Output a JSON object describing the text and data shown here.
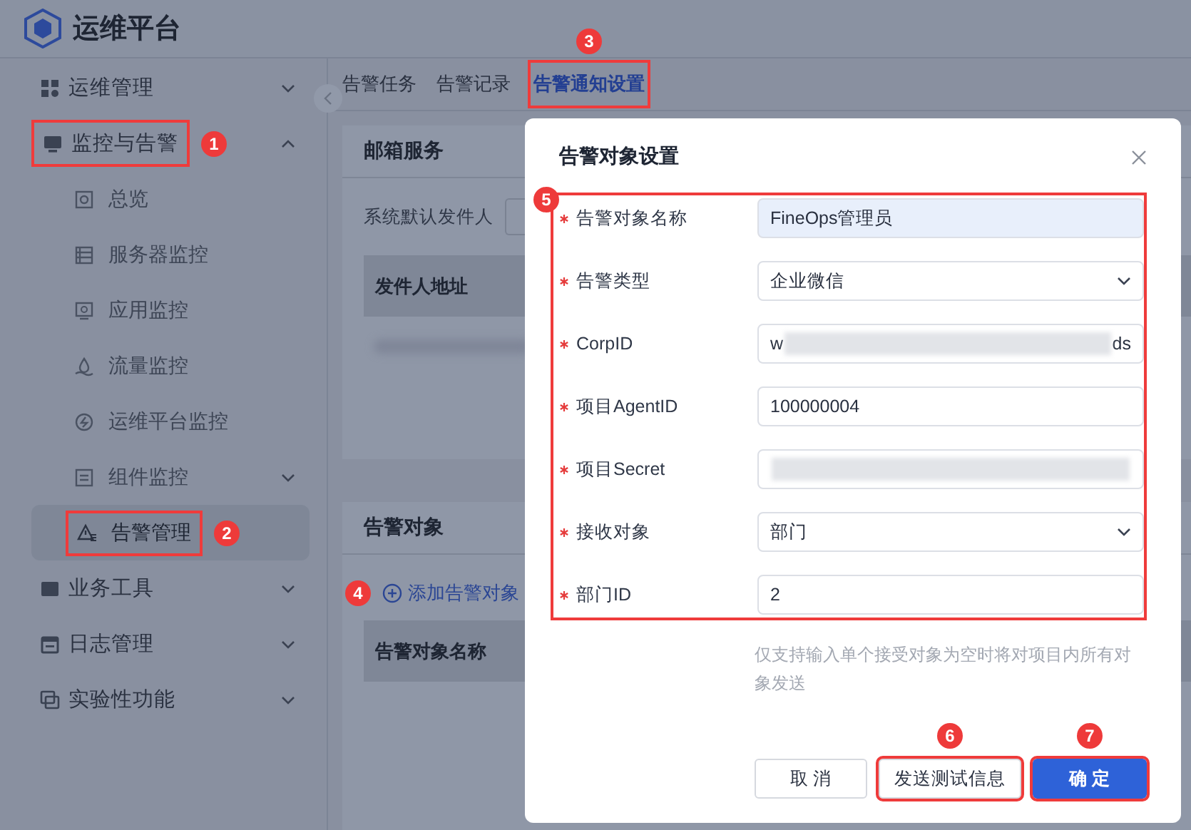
{
  "app": {
    "title": "运维平台"
  },
  "sidebar": {
    "items": [
      {
        "label": "运维管理",
        "expanded": false
      },
      {
        "label": "监控与告警",
        "expanded": true,
        "children": [
          {
            "label": "总览",
            "selected": false
          },
          {
            "label": "服务器监控",
            "selected": false
          },
          {
            "label": "应用监控",
            "selected": false
          },
          {
            "label": "流量监控",
            "selected": false
          },
          {
            "label": "运维平台监控",
            "selected": false
          },
          {
            "label": "组件监控",
            "selected": false,
            "expanded": false
          },
          {
            "label": "告警管理",
            "selected": true
          }
        ]
      },
      {
        "label": "业务工具",
        "expanded": false
      },
      {
        "label": "日志管理",
        "expanded": false
      },
      {
        "label": "实验性功能",
        "expanded": false
      }
    ]
  },
  "tabs": [
    {
      "label": "告警任务",
      "selected": false
    },
    {
      "label": "告警记录",
      "selected": false
    },
    {
      "label": "告警通知设置",
      "selected": true
    }
  ],
  "mail_card": {
    "title": "邮箱服务",
    "sender_label": "系统默认发件人",
    "table_header": "发件人地址"
  },
  "target_card": {
    "title": "告警对象",
    "add_button": "添加告警对象",
    "table_header": "告警对象名称"
  },
  "dialog": {
    "title": "告警对象设置",
    "fields": [
      {
        "label": "告警对象名称",
        "kind": "text",
        "value": "FineOps管理员",
        "required": true,
        "focused": true
      },
      {
        "label": "告警类型",
        "kind": "select",
        "value": "企业微信",
        "required": true,
        "focused": false
      },
      {
        "label": "CorpID",
        "kind": "masked",
        "value_start": "w",
        "value_end": "ds",
        "required": true,
        "focused": false
      },
      {
        "label": "项目AgentID",
        "kind": "text",
        "value": "100000004",
        "required": true,
        "focused": false
      },
      {
        "label": "项目Secret",
        "kind": "masked",
        "required": true,
        "focused": false
      },
      {
        "label": "接收对象",
        "kind": "select",
        "value": "部门",
        "required": true,
        "focused": false
      },
      {
        "label": "部门ID",
        "kind": "text",
        "value": "2",
        "required": true,
        "focused": false
      }
    ],
    "hint": "仅支持输入单个接受对象为空时将对项目内所有对象发送",
    "buttons": [
      {
        "label": "取 消",
        "kind": "default"
      },
      {
        "label": "发送测试信息",
        "kind": "default"
      },
      {
        "label": "确 定",
        "kind": "primary"
      }
    ]
  },
  "annotations": [
    {
      "number": "1"
    },
    {
      "number": "2"
    },
    {
      "number": "3"
    },
    {
      "number": "4"
    },
    {
      "number": "5"
    },
    {
      "number": "6"
    },
    {
      "number": "7"
    }
  ]
}
